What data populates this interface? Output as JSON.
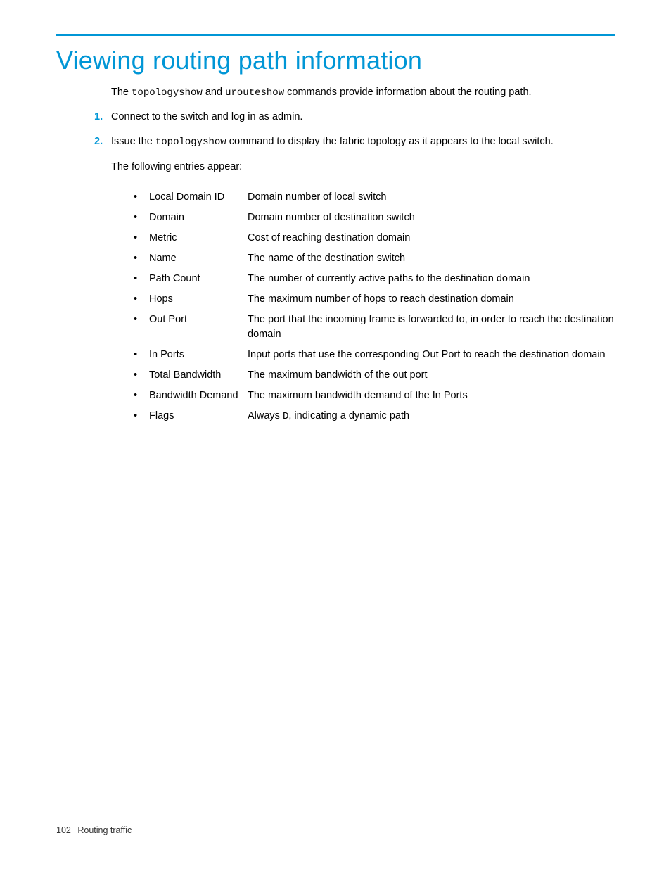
{
  "heading": "Viewing routing path information",
  "intro": {
    "prefix": "The ",
    "cmd1": "topologyshow",
    "mid": " and ",
    "cmd2": "urouteshow",
    "suffix": " commands provide information about the routing path."
  },
  "step1": "Connect to the switch and log in as admin.",
  "step2": {
    "prefix": "Issue the ",
    "cmd": "topologyshow",
    "suffix": " command to display the fabric topology as it appears to the local switch."
  },
  "substep": "The following entries appear:",
  "entries": [
    {
      "term": "Local Domain ID",
      "desc": "Domain number of local switch"
    },
    {
      "term": "Domain",
      "desc": "Domain number of destination switch"
    },
    {
      "term": "Metric",
      "desc": "Cost of reaching destination domain"
    },
    {
      "term": "Name",
      "desc": "The name of the destination switch"
    },
    {
      "term": "Path Count",
      "desc": "The number of currently active paths to the destination domain"
    },
    {
      "term": "Hops",
      "desc": "The maximum number of hops to reach destination domain"
    },
    {
      "term": "Out Port",
      "desc": "The port that the incoming frame is forwarded to, in order to reach the destination domain"
    },
    {
      "term": "In Ports",
      "desc": "Input ports that use the corresponding Out Port to reach the destination domain"
    },
    {
      "term": "Total Bandwidth",
      "desc": "The maximum bandwidth of the out port"
    },
    {
      "term": "Bandwidth Demand",
      "desc": "The maximum bandwidth demand of the In Ports"
    }
  ],
  "flags_entry": {
    "term": "Flags",
    "prefix": "Always ",
    "code": "D",
    "suffix": ", indicating a dynamic path"
  },
  "footer": {
    "page": "102",
    "section": "Routing traffic"
  }
}
